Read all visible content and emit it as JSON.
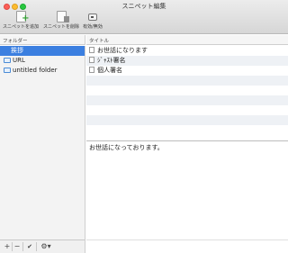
{
  "window": {
    "title": "スニペット編集"
  },
  "toolbar": {
    "add_label": "スニペットを追加",
    "delete_label": "スニペットを削除",
    "toggle_label": "有効/無効"
  },
  "columns": {
    "folder": "フォルダー",
    "title": "タイトル"
  },
  "sidebar": {
    "items": [
      {
        "label": "挨拶",
        "icon": "none",
        "selected": true
      },
      {
        "label": "URL",
        "icon": "folder-icon"
      },
      {
        "label": "untitled folder",
        "icon": "folder-icon"
      }
    ]
  },
  "snippets": {
    "items": [
      {
        "label": "お世話になります"
      },
      {
        "label": "ｼﾞｬｽﾄ署名"
      },
      {
        "label": "個人署名"
      }
    ]
  },
  "content": {
    "text": "お世話になっております。"
  },
  "bottombar": {
    "add": "+",
    "remove": "−",
    "check": "✔",
    "gear": "⚙▾"
  },
  "colors": {
    "selection": "#3b7fe0",
    "stripe": "#eef1f5"
  }
}
